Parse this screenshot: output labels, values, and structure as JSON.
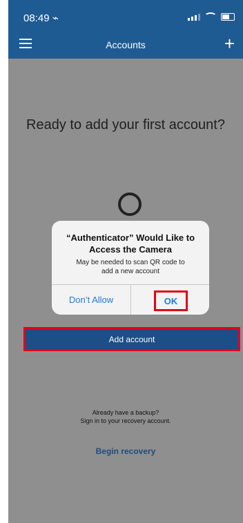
{
  "status_bar": {
    "time": "08:49 ⌁"
  },
  "nav": {
    "title": "Accounts",
    "plus": "+"
  },
  "main": {
    "headline": "Ready to add your first account?"
  },
  "dialog": {
    "title_line1": "“Authenticator” Would Like to",
    "title_line2": "Access the Camera",
    "message_line1": "May be needed to scan QR code to",
    "message_line2": "add a new account",
    "dont_allow": "Don’t Allow",
    "ok": "OK"
  },
  "add_account": "Add account",
  "backup": {
    "line1": "Already have a backup?",
    "line2": "Sign in to your recovery account.",
    "begin_recovery": "Begin recovery"
  },
  "colors": {
    "accent": "#1f5b93",
    "highlight": "#e2001a",
    "ios_blue": "#1f7ae0"
  }
}
